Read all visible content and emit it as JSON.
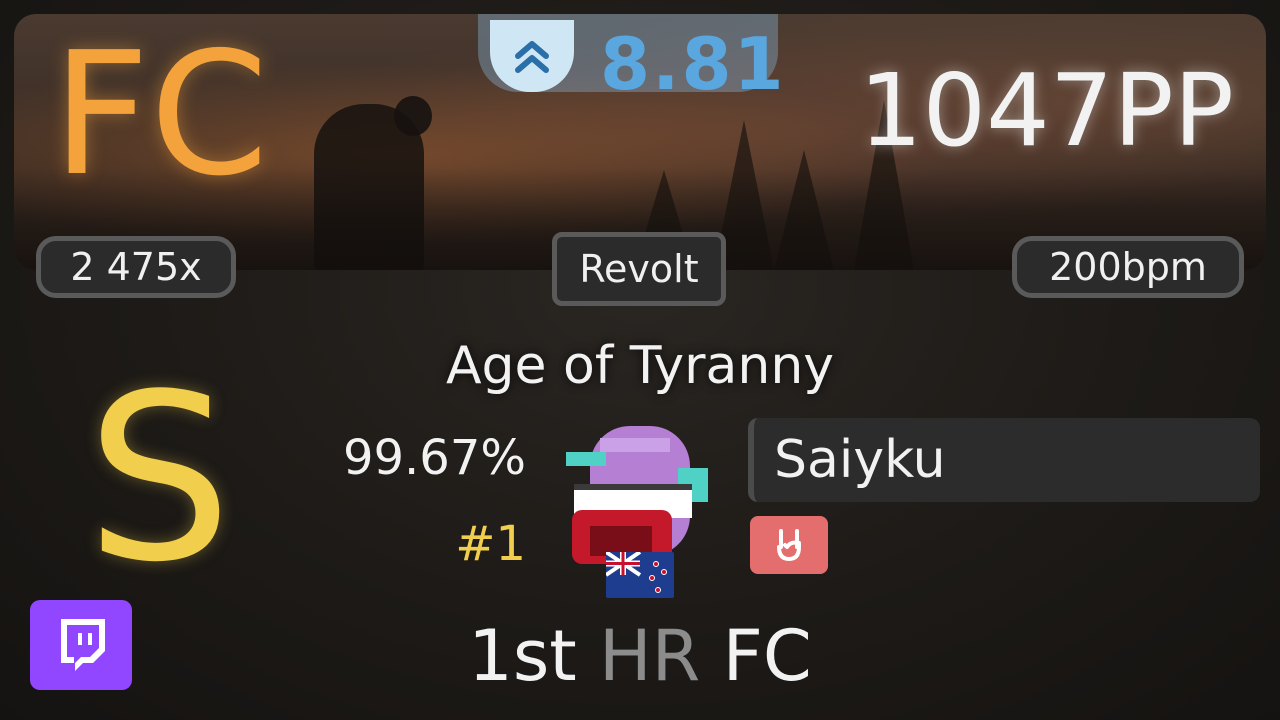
{
  "grade": {
    "label": "FC",
    "color": "#f4a33c"
  },
  "difficulty": {
    "stars": "8.81",
    "icon": "chevrons-up-icon",
    "color": "#5aa7e0"
  },
  "pp": "1047PP",
  "chips": {
    "combo": "2 475x",
    "mapper": "Revolt",
    "bpm": "200bpm"
  },
  "beatmap": {
    "title": "Age of Tyranny"
  },
  "rank": {
    "letter": "S",
    "color": "#f1cf4d"
  },
  "score": {
    "accuracy": "99.67%",
    "placement": "#1"
  },
  "player": {
    "name": "Saiyku",
    "avatar": "pixel-avatar",
    "country_flag": "new-zealand-flag-icon",
    "mod_icon": "rock-hand-icon"
  },
  "footer": {
    "place": "1st",
    "mods": "HR",
    "result": "FC"
  },
  "platform": {
    "icon": "twitch-icon",
    "color": "#9146ff"
  }
}
